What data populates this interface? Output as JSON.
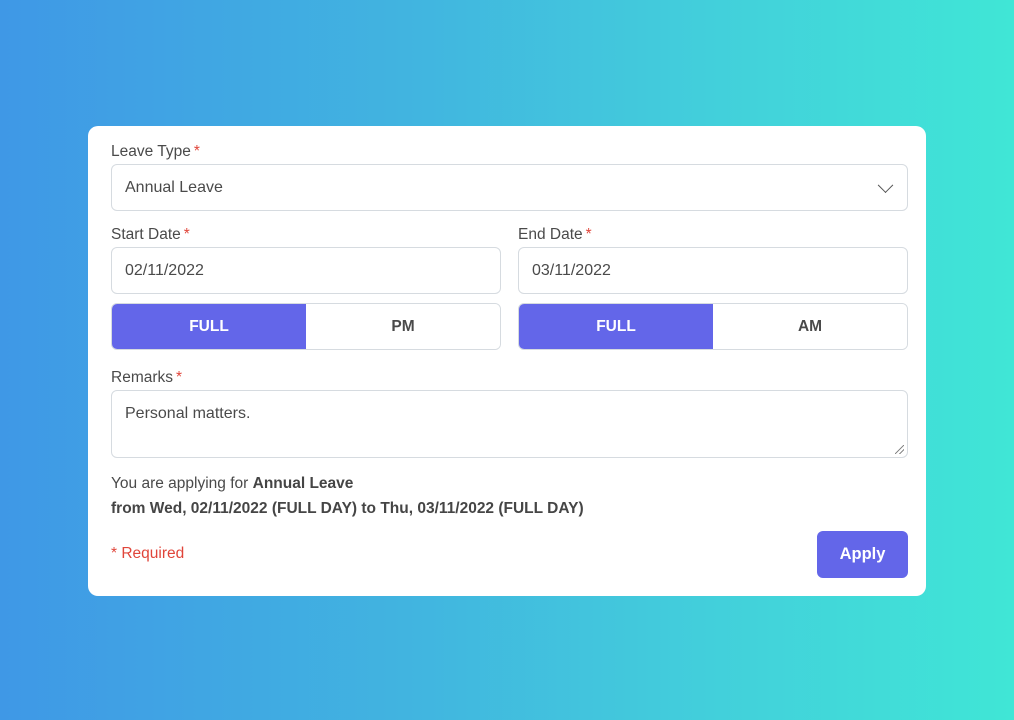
{
  "form": {
    "leave_type": {
      "label": "Leave Type",
      "required_mark": "*",
      "value": "Annual Leave",
      "icon": "chevron-down-icon"
    },
    "start_date": {
      "label": "Start Date",
      "required_mark": "*",
      "value": "02/11/2022",
      "options": [
        {
          "label": "FULL",
          "selected": true
        },
        {
          "label": "PM",
          "selected": false
        }
      ]
    },
    "end_date": {
      "label": "End Date",
      "required_mark": "*",
      "value": "03/11/2022",
      "options": [
        {
          "label": "FULL",
          "selected": true
        },
        {
          "label": "AM",
          "selected": false
        }
      ]
    },
    "remarks": {
      "label": "Remarks",
      "required_mark": "*",
      "value": "Personal matters."
    },
    "summary": {
      "prefix": "You are applying for",
      "leave_type": "Annual Leave",
      "detail": "from Wed, 02/11/2022 (FULL DAY) to Thu, 03/11/2022 (FULL DAY)"
    },
    "required_note": "* Required",
    "apply_label": "Apply"
  },
  "colors": {
    "accent": "#6366e9",
    "required": "#e0453a",
    "background_start": "#3f98e6",
    "background_end": "#40e6d6"
  }
}
